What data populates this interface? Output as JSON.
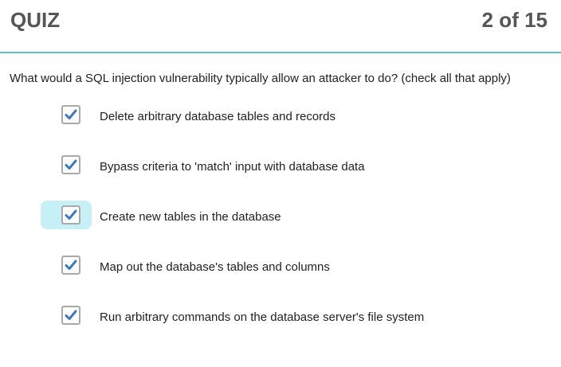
{
  "header": {
    "title": "QUIZ",
    "progress": "2 of 15"
  },
  "accent_color": "#5bc4cf",
  "check_color": "#3a78c0",
  "question": {
    "text": "What would a SQL injection vulnerability typically allow an attacker to do? (check all that apply)"
  },
  "options": [
    {
      "label": "Delete arbitrary database tables and records",
      "checked": true,
      "focused": false
    },
    {
      "label": "Bypass criteria to 'match' input with database data",
      "checked": true,
      "focused": false
    },
    {
      "label": "Create new tables in the database",
      "checked": true,
      "focused": true
    },
    {
      "label": "Map out the database's tables and columns",
      "checked": true,
      "focused": false
    },
    {
      "label": "Run arbitrary commands on the database server's file system",
      "checked": true,
      "focused": false
    }
  ]
}
